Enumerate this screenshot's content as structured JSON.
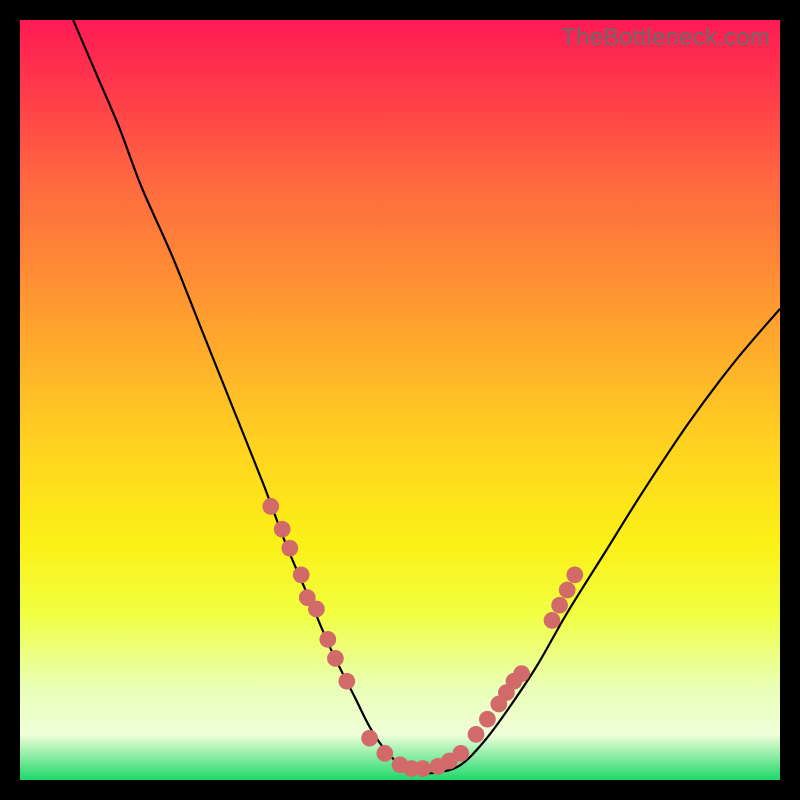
{
  "watermark": "TheBottleneck.com",
  "colors": {
    "bead": "#d36a6a",
    "curve": "#000000",
    "frame_bg_stops": [
      "#ff1a54",
      "#ff3d4a",
      "#ff6b3f",
      "#ff8b35",
      "#ffb12a",
      "#ffd51f",
      "#fbf117",
      "#f1ff41",
      "#e9ffb7",
      "#f0ffd9",
      "#1dd86a"
    ]
  },
  "chart_data": {
    "type": "line",
    "title": "",
    "xlabel": "",
    "ylabel": "",
    "xlim": [
      0,
      100
    ],
    "ylim": [
      0,
      100
    ],
    "grid": false,
    "legend": false,
    "series": [
      {
        "name": "bottleneck-curve",
        "x": [
          7,
          10,
          13,
          16,
          20,
          24,
          28,
          32,
          35,
          38,
          41,
          44,
          46,
          48,
          50,
          52,
          55,
          58,
          61,
          64,
          68,
          72,
          77,
          82,
          88,
          94,
          100
        ],
        "y": [
          100,
          93,
          86,
          78,
          69,
          59,
          49,
          39,
          31,
          24,
          17,
          11,
          7,
          4,
          2,
          1,
          1,
          2,
          5,
          9,
          15,
          22,
          30,
          38,
          47,
          55,
          62
        ]
      }
    ],
    "points": [
      {
        "name": "left-beads",
        "x": [
          33,
          34.5,
          35.5,
          37,
          37.8,
          39,
          40.5,
          41.5,
          43
        ],
        "y": [
          36,
          33,
          30.5,
          27,
          24,
          22.5,
          18.5,
          16,
          13
        ]
      },
      {
        "name": "valley-beads",
        "x": [
          46,
          48,
          50,
          51.5,
          53,
          55,
          56.5,
          58
        ],
        "y": [
          5.5,
          3.5,
          2,
          1.5,
          1.5,
          1.8,
          2.5,
          3.5
        ]
      },
      {
        "name": "right-beads",
        "x": [
          60,
          61.5,
          63,
          64,
          65,
          66,
          70,
          71,
          72,
          73
        ],
        "y": [
          6,
          8,
          10,
          11.5,
          13,
          14,
          21,
          23,
          25,
          27
        ]
      }
    ],
    "bead_radius": 1.1
  }
}
